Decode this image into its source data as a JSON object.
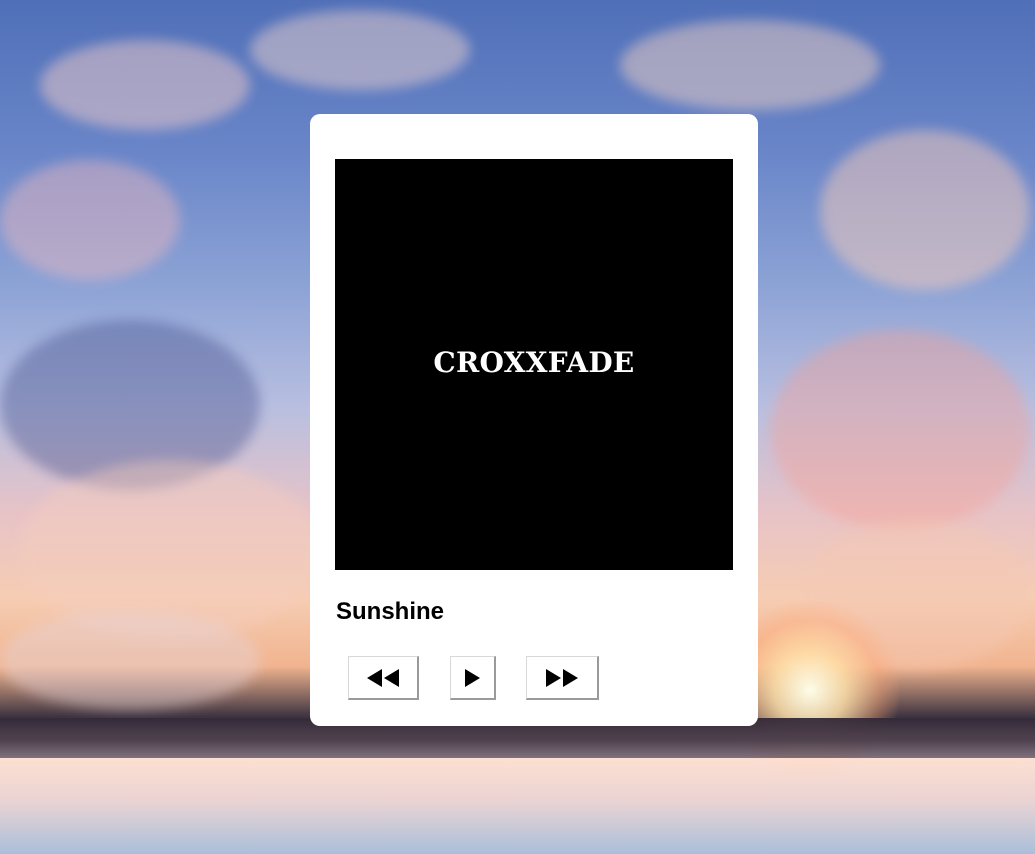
{
  "background": {
    "icon": "sunset-landscape",
    "colors": {
      "sky_top": "#4f6fb8",
      "sky_mid": "#8ea4d6",
      "glow": "#f6cdb3",
      "horizon": "#3b3240",
      "water": "#cfd6e6"
    }
  },
  "player": {
    "cover_text": "CROXXFADE",
    "track_title": "Sunshine",
    "controls": {
      "prev_icon": "rewind-icon",
      "play_icon": "play-icon",
      "next_icon": "fast-forward-icon"
    }
  }
}
